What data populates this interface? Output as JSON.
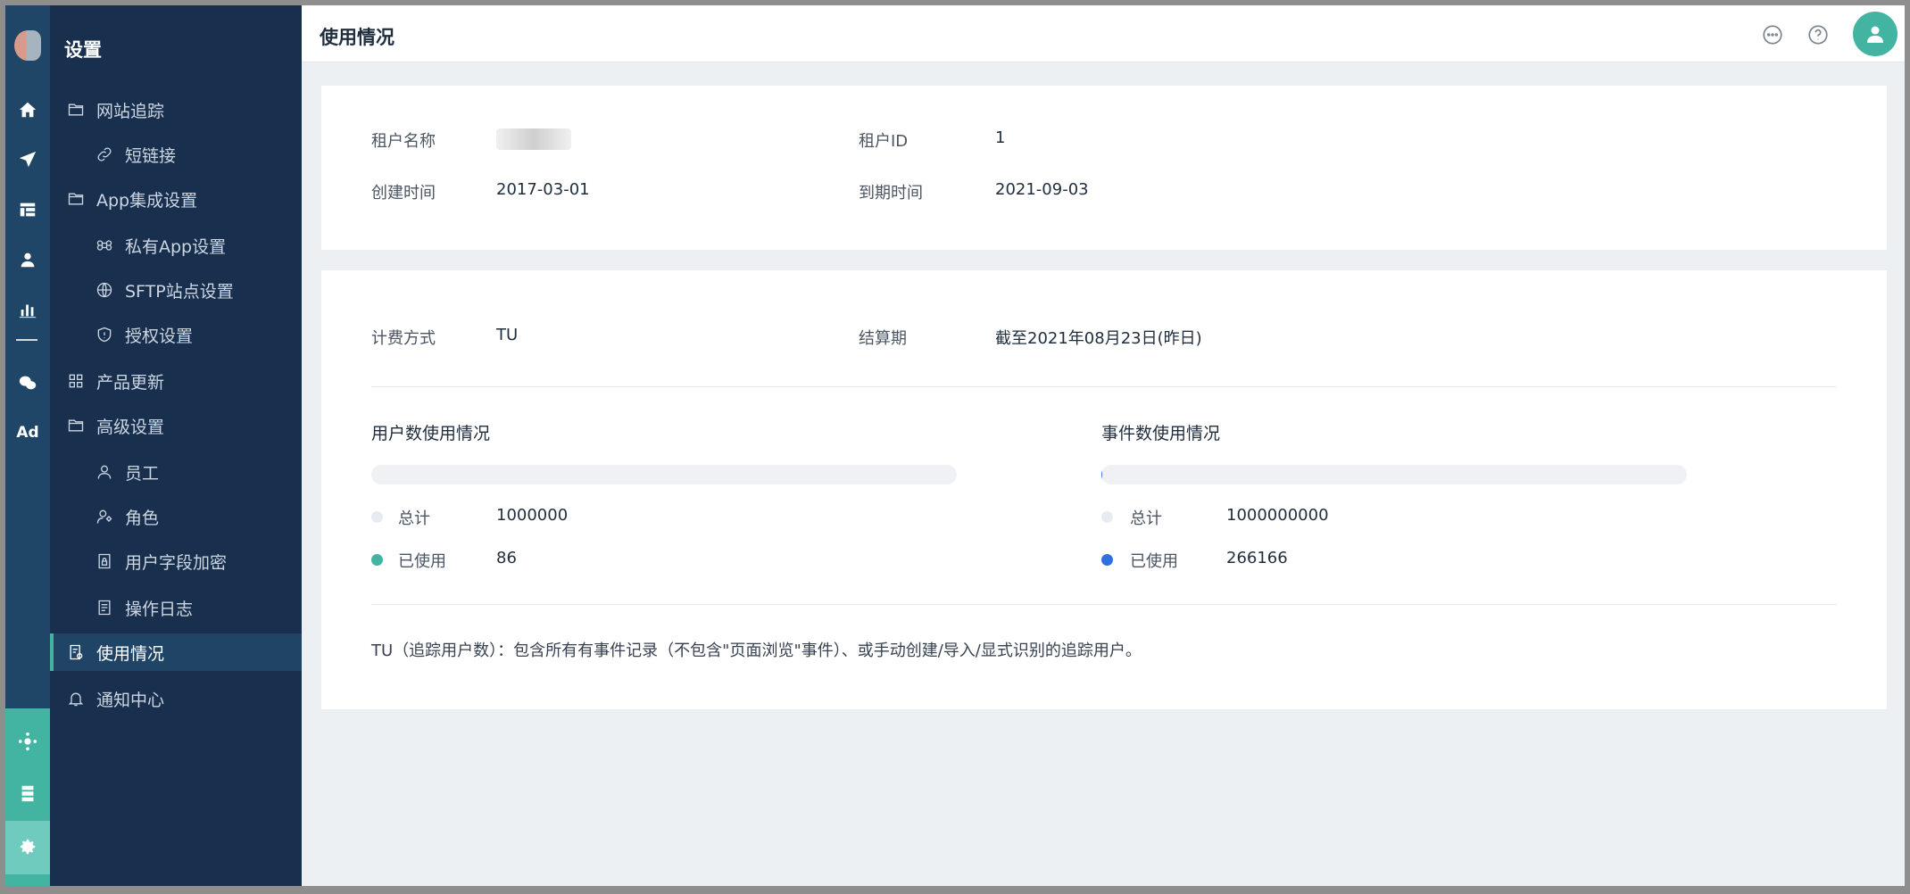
{
  "app": {
    "colors": {
      "accent": "#44b4a2",
      "sidebar_bg": "#18304d",
      "rail_bg": "#1f4666",
      "user_used_dot": "#44b4a2",
      "event_used_dot": "#2f6fe0"
    }
  },
  "rail": {
    "items": [
      {
        "icon": "home-icon"
      },
      {
        "icon": "send-icon"
      },
      {
        "icon": "table-icon"
      },
      {
        "icon": "user-icon"
      },
      {
        "icon": "bar-chart-icon"
      },
      {
        "icon": "wechat-icon"
      },
      {
        "icon": "ad-icon",
        "label": "Ad"
      }
    ],
    "bottom_items": [
      {
        "icon": "network-icon"
      },
      {
        "icon": "server-icon"
      },
      {
        "icon": "gear-icon"
      }
    ]
  },
  "sidebar": {
    "title": "设置",
    "items": [
      {
        "label": "网站追踪",
        "icon": "folder-icon",
        "level": 1
      },
      {
        "label": "短链接",
        "icon": "link-icon",
        "level": 2
      },
      {
        "label": "App集成设置",
        "icon": "folder-icon",
        "level": 1
      },
      {
        "label": "私有App设置",
        "icon": "command-icon",
        "level": 2
      },
      {
        "label": "SFTP站点设置",
        "icon": "globe-icon",
        "level": 2
      },
      {
        "label": "授权设置",
        "icon": "shield-icon",
        "level": 2
      },
      {
        "label": "产品更新",
        "icon": "grid-icon",
        "level": 1
      },
      {
        "label": "高级设置",
        "icon": "folder-icon",
        "level": 1
      },
      {
        "label": "员工",
        "icon": "person-icon",
        "level": 2
      },
      {
        "label": "角色",
        "icon": "person-role-icon",
        "level": 2
      },
      {
        "label": "用户字段加密",
        "icon": "encrypt-doc-icon",
        "level": 2
      },
      {
        "label": "操作日志",
        "icon": "log-icon",
        "level": 2
      },
      {
        "label": "使用情况",
        "icon": "usage-doc-icon",
        "level": 1,
        "active": true
      },
      {
        "label": "通知中心",
        "icon": "bell-icon",
        "level": 1
      }
    ]
  },
  "header": {
    "title": "使用情况",
    "icons": [
      "chat-icon",
      "help-icon",
      "avatar-icon"
    ]
  },
  "tenant": {
    "name_label": "租户名称",
    "id_label": "租户ID",
    "id_value": "1",
    "created_label": "创建时间",
    "created_value": "2017-03-01",
    "expire_label": "到期时间",
    "expire_value": "2021-09-03"
  },
  "billing": {
    "method_label": "计费方式",
    "method_value": "TU",
    "period_label": "结算期",
    "period_value": "截至2021年08月23日(昨日)"
  },
  "usage": {
    "users": {
      "title": "用户数使用情况",
      "total_label": "总计",
      "total_value": "1000000",
      "used_label": "已使用",
      "used_value": "86",
      "used_fraction": 8.6e-05
    },
    "events": {
      "title": "事件数使用情况",
      "total_label": "总计",
      "total_value": "1000000000",
      "used_label": "已使用",
      "used_value": "266166",
      "used_fraction": 0.000266
    }
  },
  "note": "TU（追踪用户数）：包含所有有事件记录（不包含\"页面浏览\"事件）、或手动创建/导入/显式识别的追踪用户。"
}
